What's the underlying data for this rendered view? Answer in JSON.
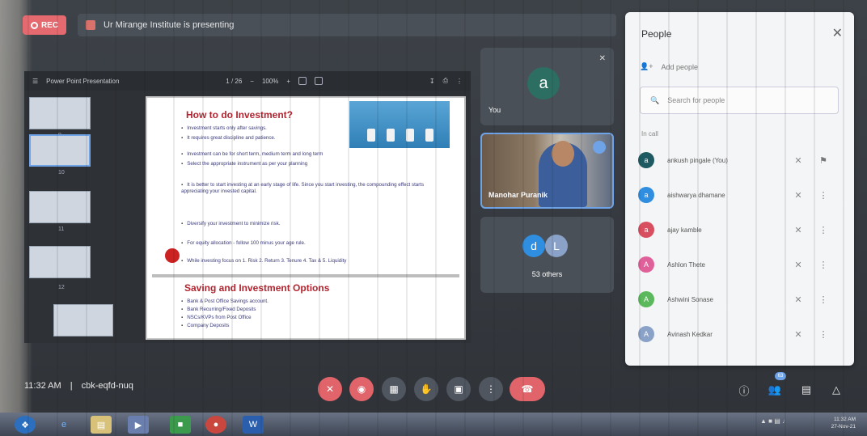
{
  "rec_label": "REC",
  "presenting_text": "Ur Mirange Institute is presenting",
  "presentation": {
    "file_name": "Power Point Presentation",
    "page_display": "1 / 26",
    "zoom_display": "100%",
    "thumb_numbers": [
      "9",
      "10",
      "11",
      "12"
    ],
    "slide1": {
      "title": "How to do Investment?",
      "bullets": [
        "Investment starts only after savings.",
        "It requires great discipline and patience.",
        "Investment can be for short term, medium term and long term",
        "Select the appropriate instrument as per your planning",
        "It is better to start investing at an early stage of life. Since you start investing, the compounding effect starts appreciating your invested capital.",
        "Diversify your investment to minimize risk.",
        "For equity allocation - follow 100 minus your age rule.",
        "While investing focus on 1. Risk 2. Return 3. Tenure 4. Tax & 5. Liquidity"
      ]
    },
    "slide2": {
      "title": "Saving and Investment Options",
      "bullets": [
        "Bank & Post Office Savings account.",
        "Bank Recurring/Fixed Deposits",
        "NSCs/KVPs from Post Office",
        "Company Deposits"
      ]
    }
  },
  "tiles": {
    "you": {
      "avatar_letter": "a",
      "label": "You"
    },
    "camera": {
      "name": "Manohar Puranik"
    },
    "others": {
      "avatar_1": "d",
      "avatar_2": "L",
      "label": "53 others"
    }
  },
  "people_panel": {
    "title": "People",
    "add_people": "Add people",
    "search_placeholder": "Search for people",
    "in_call_label": "In call",
    "people": [
      {
        "initial": "a",
        "name": "ankush pingale (You)",
        "color": "#1f5a63"
      },
      {
        "initial": "a",
        "name": "aishwarya dhamane",
        "color": "#2f8ee0"
      },
      {
        "initial": "a",
        "name": "ajay kamble",
        "color": "#d8505f"
      },
      {
        "initial": "A",
        "name": "Ashlon Thete",
        "color": "#e0609a"
      },
      {
        "initial": "A",
        "name": "Ashwini Sonase",
        "color": "#5cb85c"
      },
      {
        "initial": "A",
        "name": "Avinash Kedkar",
        "color": "#8aa2c8"
      }
    ]
  },
  "bottom_bar": {
    "time": "11:32 AM",
    "separator": "|",
    "meeting_code": "cbk-eqfd-nuq",
    "participant_count": "63"
  },
  "taskbar": {
    "clock_time": "11:32 AM",
    "clock_date": "27-Nov-21"
  }
}
